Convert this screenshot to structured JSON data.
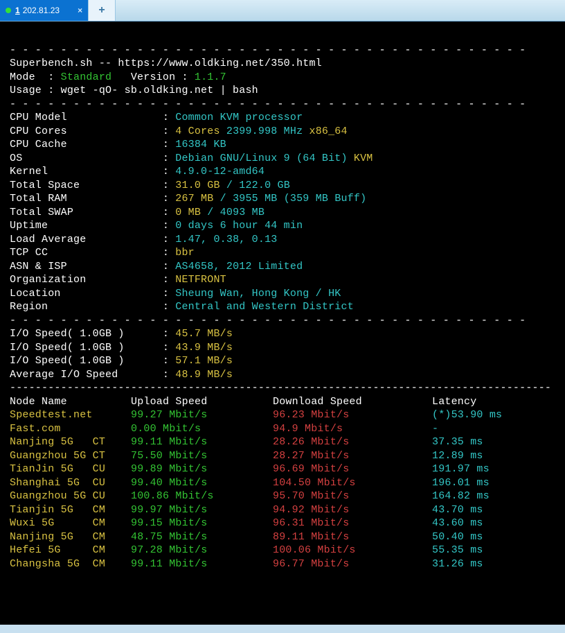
{
  "tabs": {
    "active": {
      "index": "1",
      "ip": "202.81.23"
    }
  },
  "header": {
    "title_line": "Superbench.sh -- https://www.oldking.net/350.html",
    "mode_label": "Mode  : ",
    "mode_value": "Standard",
    "version_label": "   Version : ",
    "version_value": "1.1.7",
    "usage_line": "Usage : wget -qO- sb.oldking.net | bash"
  },
  "sysinfo": [
    {
      "label": "CPU Model",
      "value": "Common KVM processor",
      "color": "cyn"
    },
    {
      "label": "CPU Cores",
      "value_parts": [
        {
          "text": "4 Cores",
          "cls": "ylw"
        },
        {
          "text": " 2399.998 MHz ",
          "cls": "cyn"
        },
        {
          "text": "x86_64",
          "cls": "ylw"
        }
      ]
    },
    {
      "label": "CPU Cache",
      "value": "16384 KB",
      "color": "cyn"
    },
    {
      "label": "OS",
      "value_parts": [
        {
          "text": "Debian GNU/Linux 9 (64 Bit) ",
          "cls": "cyn"
        },
        {
          "text": "KVM",
          "cls": "ylw"
        }
      ]
    },
    {
      "label": "Kernel",
      "value": "4.9.0-12-amd64",
      "color": "cyn"
    },
    {
      "label": "Total Space",
      "value_parts": [
        {
          "text": "31.0 GB ",
          "cls": "ylw"
        },
        {
          "text": "/ ",
          "cls": "cyn"
        },
        {
          "text": "122.0 GB",
          "cls": "cyn"
        }
      ]
    },
    {
      "label": "Total RAM",
      "value_parts": [
        {
          "text": "267 MB ",
          "cls": "ylw"
        },
        {
          "text": "/ ",
          "cls": "cyn"
        },
        {
          "text": "3955 MB ",
          "cls": "cyn"
        },
        {
          "text": "(359 MB Buff)",
          "cls": "cyn"
        }
      ]
    },
    {
      "label": "Total SWAP",
      "value_parts": [
        {
          "text": "0 MB ",
          "cls": "ylw"
        },
        {
          "text": "/ ",
          "cls": "cyn"
        },
        {
          "text": "4093 MB",
          "cls": "cyn"
        }
      ]
    },
    {
      "label": "Uptime",
      "value": "0 days 6 hour 44 min",
      "color": "cyn"
    },
    {
      "label": "Load Average",
      "value": "1.47, 0.38, 0.13",
      "color": "cyn"
    },
    {
      "label": "TCP CC",
      "value": "bbr",
      "color": "ylw"
    },
    {
      "label": "ASN & ISP",
      "value": "AS4658, 2012 Limited",
      "color": "cyn"
    },
    {
      "label": "Organization",
      "value": "NETFRONT",
      "color": "ylw"
    },
    {
      "label": "Location",
      "value": "Sheung Wan, Hong Kong / HK",
      "color": "cyn"
    },
    {
      "label": "Region",
      "value": "Central and Western District",
      "color": "cyn"
    }
  ],
  "io": [
    {
      "label": "I/O Speed( 1.0GB )",
      "value": "45.7 MB/s"
    },
    {
      "label": "I/O Speed( 1.0GB )",
      "value": "43.9 MB/s"
    },
    {
      "label": "I/O Speed( 1.0GB )",
      "value": "57.1 MB/s"
    },
    {
      "label": "Average I/O Speed",
      "value": "48.9 MB/s"
    }
  ],
  "speed_header": {
    "c0": "Node Name",
    "c1": "Upload Speed",
    "c2": "Download Speed",
    "c3": "Latency"
  },
  "speed": [
    {
      "name": "Speedtest.net",
      "up": "99.27 Mbit/s",
      "down": "96.23 Mbit/s",
      "lat": "(*)53.90 ms"
    },
    {
      "name": "Fast.com",
      "up": "0.00 Mbit/s",
      "down": "94.9 Mbit/s",
      "lat": "-"
    },
    {
      "name": "Nanjing 5G   CT",
      "up": "99.11 Mbit/s",
      "down": "28.26 Mbit/s",
      "lat": "37.35 ms"
    },
    {
      "name": "Guangzhou 5G CT",
      "up": "75.50 Mbit/s",
      "down": "28.27 Mbit/s",
      "lat": "12.89 ms"
    },
    {
      "name": "TianJin 5G   CU",
      "up": "99.89 Mbit/s",
      "down": "96.69 Mbit/s",
      "lat": "191.97 ms"
    },
    {
      "name": "Shanghai 5G  CU",
      "up": "99.40 Mbit/s",
      "down": "104.50 Mbit/s",
      "lat": "196.01 ms"
    },
    {
      "name": "Guangzhou 5G CU",
      "up": "100.86 Mbit/s",
      "down": "95.70 Mbit/s",
      "lat": "164.82 ms"
    },
    {
      "name": "Tianjin 5G   CM",
      "up": "99.97 Mbit/s",
      "down": "94.92 Mbit/s",
      "lat": "43.70 ms"
    },
    {
      "name": "Wuxi 5G      CM",
      "up": "99.15 Mbit/s",
      "down": "96.31 Mbit/s",
      "lat": "43.60 ms"
    },
    {
      "name": "Nanjing 5G   CM",
      "up": "48.75 Mbit/s",
      "down": "89.11 Mbit/s",
      "lat": "50.40 ms"
    },
    {
      "name": "Hefei 5G     CM",
      "up": "97.28 Mbit/s",
      "down": "100.06 Mbit/s",
      "lat": "55.35 ms"
    },
    {
      "name": "Changsha 5G  CM",
      "up": "99.11 Mbit/s",
      "down": "96.77 Mbit/s",
      "lat": "31.26 ms"
    }
  ],
  "separator71": "- - - - - - - - - - - - - - - - - - - - - - - - - - - - - - - - - - - - - - - - -",
  "separator85": "-------------------------------------------------------------------------------------"
}
